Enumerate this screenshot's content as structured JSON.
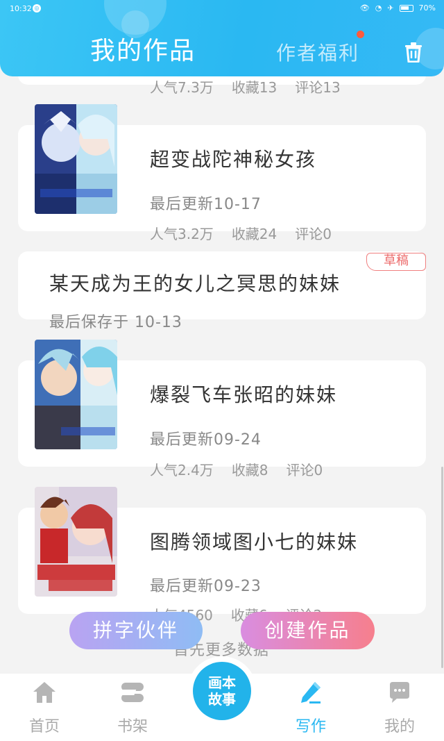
{
  "status": {
    "time": "10:32",
    "battery": "70%"
  },
  "header": {
    "title": "我的作品",
    "tab_welfare": "作者福利"
  },
  "works": [
    {
      "stats": {
        "popularity": "人气7.3万",
        "favorites": "收藏13",
        "comments": "评论13"
      }
    },
    {
      "title": "超变战陀神秘女孩",
      "updated": "最后更新10-17",
      "stats": {
        "popularity": "人气3.2万",
        "favorites": "收藏24",
        "comments": "评论0"
      }
    },
    {
      "title": "某天成为王的女儿之冥思的妹妹",
      "saved": "最后保存于 10-13",
      "badge": "草稿"
    },
    {
      "title": "爆裂飞车张昭的妹妹",
      "updated": "最后更新09-24",
      "stats": {
        "popularity": "人气2.4万",
        "favorites": "收藏8",
        "comments": "评论0"
      }
    },
    {
      "title": "图腾领域图小七的妹妹",
      "updated": "最后更新09-23",
      "stats": {
        "popularity": "人气4560",
        "favorites": "收藏6",
        "comments": "评论2"
      }
    }
  ],
  "actions": {
    "partner": "拼字伙伴",
    "create": "创建作品",
    "load_more": "首先更多数据"
  },
  "nav": {
    "home": "首页",
    "shelf": "书架",
    "center": "画本故事",
    "write": "写作",
    "mine": "我的"
  },
  "colors": {
    "accent": "#2ab8f2",
    "draft": "#ec6a6a"
  }
}
